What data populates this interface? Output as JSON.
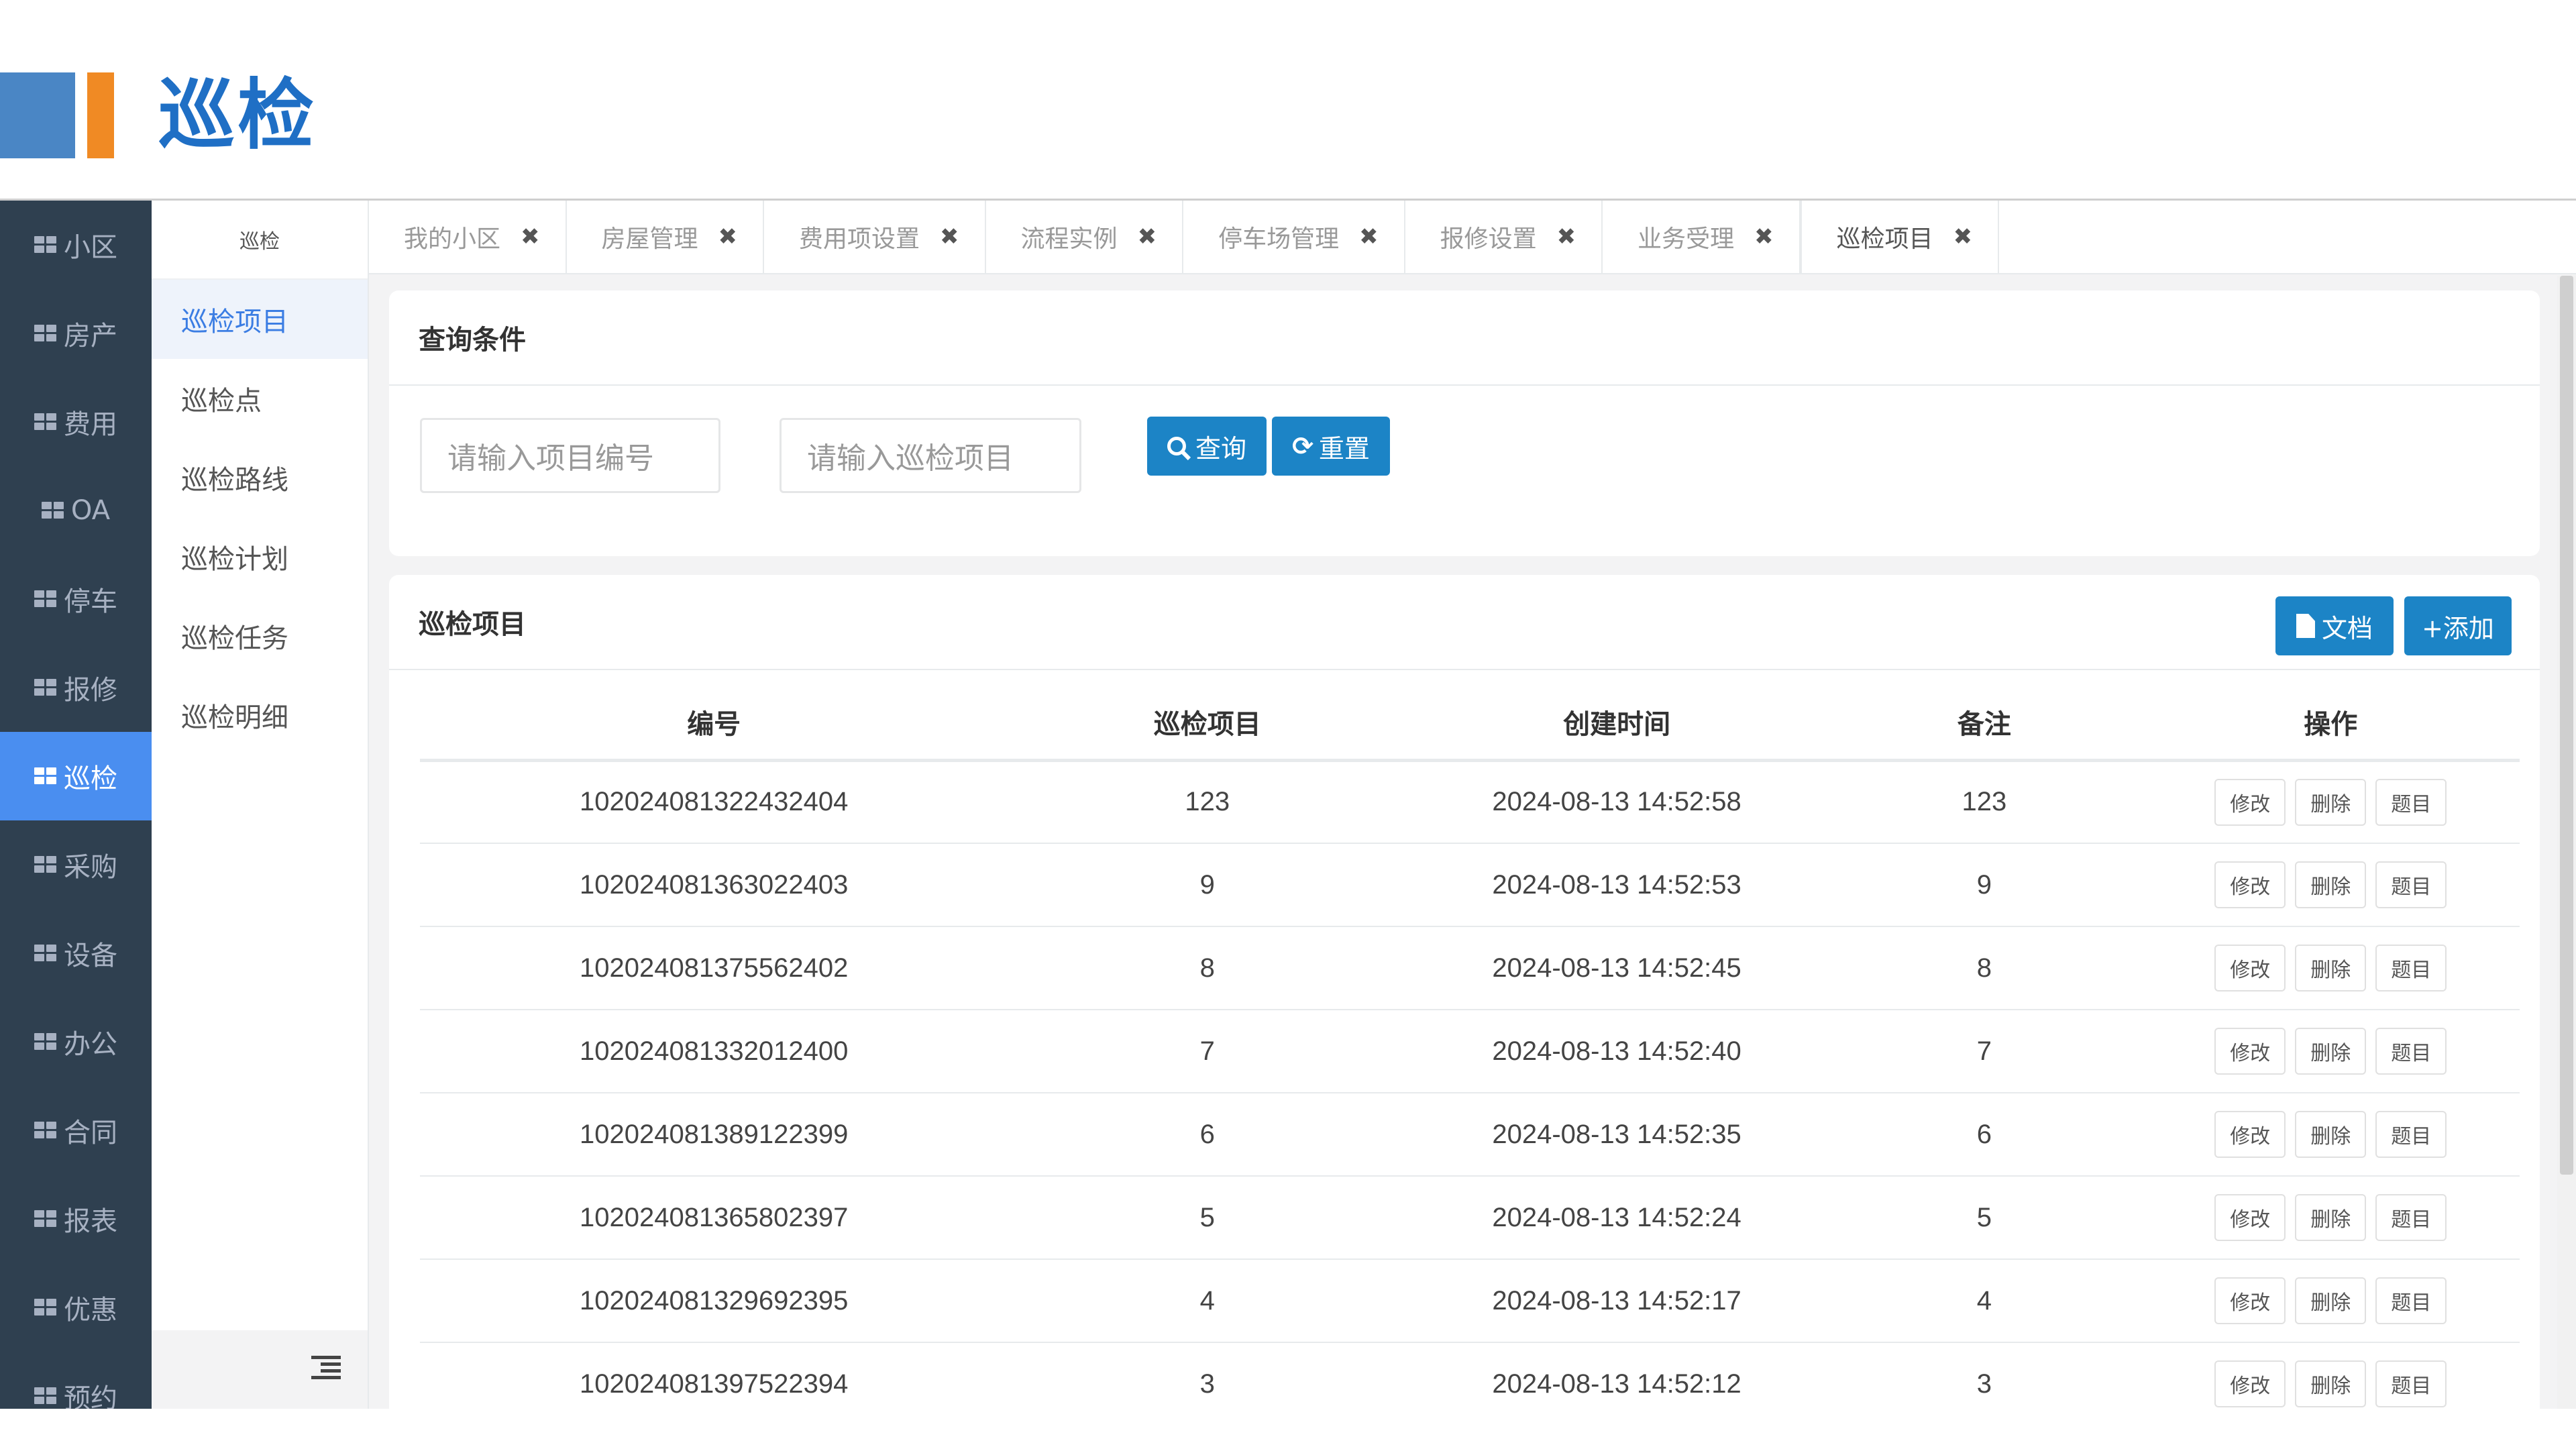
{
  "slide": {
    "title": "巡检"
  },
  "colors": {
    "nav_bg": "#2f4050",
    "nav_active": "#4a8ef0",
    "primary_button": "#1c84c6",
    "title_blue": "#1f6fc5",
    "accent_orange": "#f08a24"
  },
  "nav": {
    "items": [
      {
        "label": "小区"
      },
      {
        "label": "房产"
      },
      {
        "label": "费用"
      },
      {
        "label": "OA"
      },
      {
        "label": "停车"
      },
      {
        "label": "报修"
      },
      {
        "label": "巡检"
      },
      {
        "label": "采购"
      },
      {
        "label": "设备"
      },
      {
        "label": "办公"
      },
      {
        "label": "合同"
      },
      {
        "label": "报表"
      },
      {
        "label": "优惠"
      },
      {
        "label": "预约"
      }
    ],
    "active": "巡检",
    "icon": "grid-icon"
  },
  "submenu": {
    "title": "巡检",
    "items": [
      {
        "label": "巡检项目"
      },
      {
        "label": "巡检点"
      },
      {
        "label": "巡检路线"
      },
      {
        "label": "巡检计划"
      },
      {
        "label": "巡检任务"
      },
      {
        "label": "巡检明细"
      }
    ],
    "active": "巡检项目"
  },
  "tabs": [
    {
      "label": "我的小区"
    },
    {
      "label": "房屋管理"
    },
    {
      "label": "费用项设置"
    },
    {
      "label": "流程实例"
    },
    {
      "label": "停车场管理"
    },
    {
      "label": "报修设置"
    },
    {
      "label": "业务受理"
    },
    {
      "label": "巡检项目"
    }
  ],
  "tab_close_glyph": "✖",
  "search": {
    "title": "查询条件",
    "placeholder_code": "请输入项目编号",
    "placeholder_item": "请输入巡检项目",
    "search_label": "查询",
    "reset_label": "重置"
  },
  "list": {
    "title": "巡检项目",
    "doc_label": "文档",
    "add_label": "+添加",
    "columns": [
      "编号",
      "巡检项目",
      "创建时间",
      "备注",
      "操作"
    ],
    "actions": [
      "修改",
      "删除",
      "题目"
    ],
    "rows": [
      [
        "102024081322432404",
        "123",
        "2024-08-13 14:52:58",
        "123"
      ],
      [
        "102024081363022403",
        "9",
        "2024-08-13 14:52:53",
        "9"
      ],
      [
        "102024081375562402",
        "8",
        "2024-08-13 14:52:45",
        "8"
      ],
      [
        "102024081332012400",
        "7",
        "2024-08-13 14:52:40",
        "7"
      ],
      [
        "102024081389122399",
        "6",
        "2024-08-13 14:52:35",
        "6"
      ],
      [
        "102024081365802397",
        "5",
        "2024-08-13 14:52:24",
        "5"
      ],
      [
        "102024081329692395",
        "4",
        "2024-08-13 14:52:17",
        "4"
      ],
      [
        "102024081397522394",
        "3",
        "2024-08-13 14:52:12",
        "3"
      ]
    ]
  }
}
